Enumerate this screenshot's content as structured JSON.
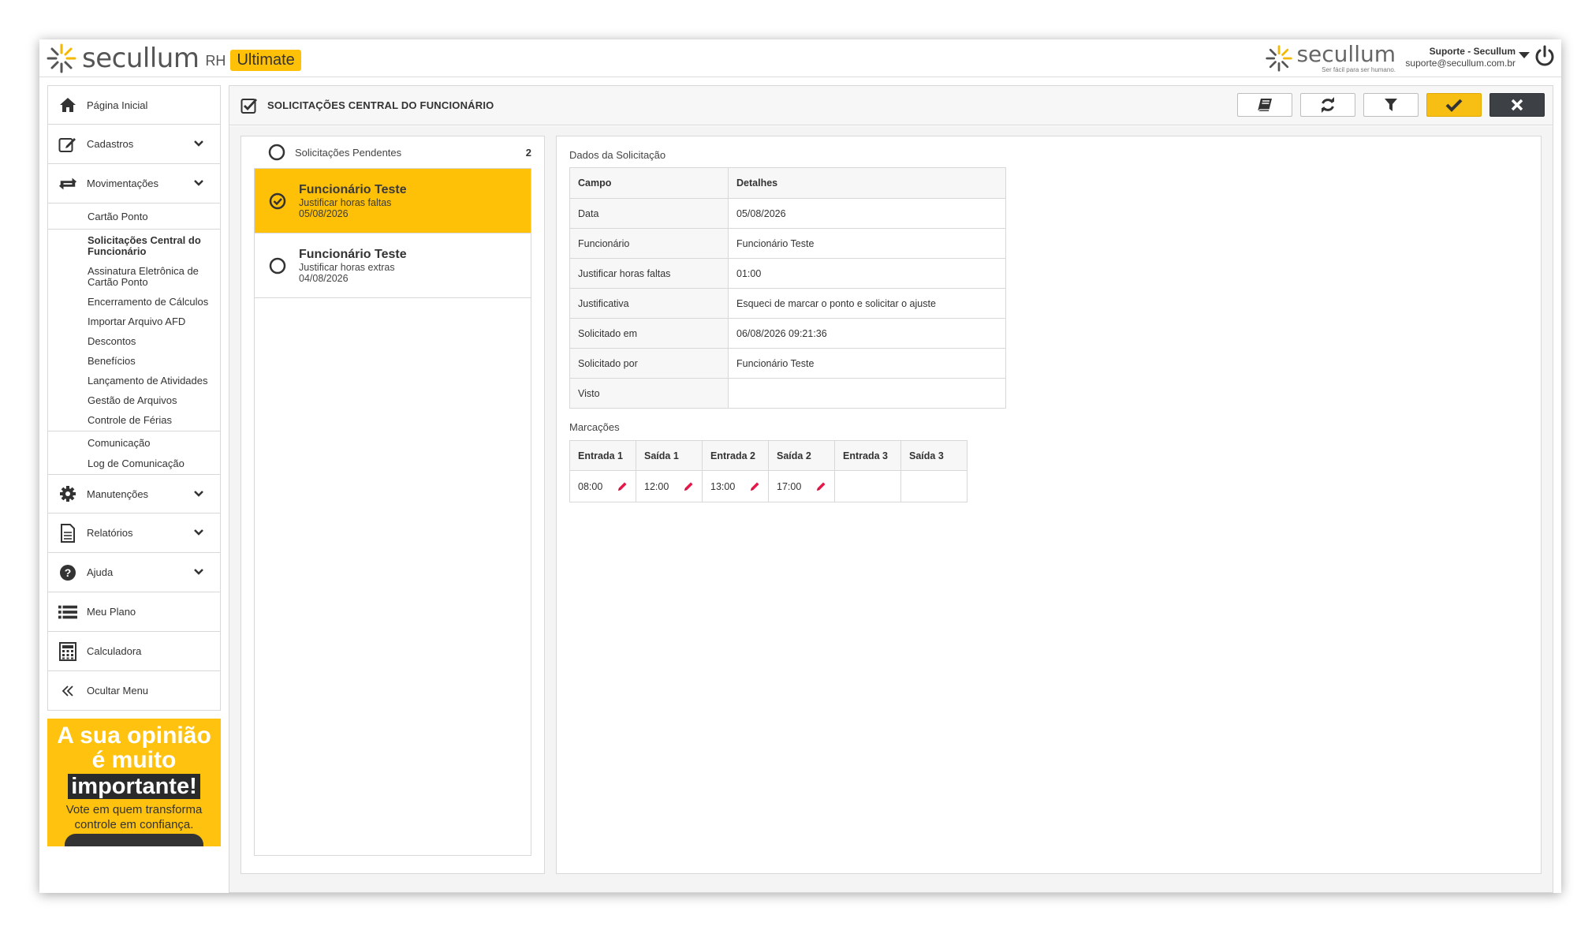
{
  "app": {
    "brand": "secullum",
    "product": "RH",
    "edition": "Ultimate",
    "right_brand": "secullum",
    "right_tagline": "Ser fácil para ser humano.",
    "accent_color": "#ffc107"
  },
  "user": {
    "name": "Suporte - Secullum",
    "email": "suporte@secullum.com.br"
  },
  "sidebar": {
    "items": [
      {
        "label": "Página Inicial",
        "icon": "home-icon"
      },
      {
        "label": "Cadastros",
        "icon": "edit-icon"
      },
      {
        "label": "Movimentações",
        "icon": "transfer-icon"
      }
    ],
    "submenu": [
      "Cartão Ponto",
      "Solicitações Central do Funcionário",
      "Assinatura Eletrônica de Cartão Ponto",
      "Encerramento de Cálculos",
      "Importar Arquivo AFD",
      "Descontos",
      "Benefícios",
      "Lançamento de Atividades",
      "Gestão de Arquivos",
      "Controle de Férias",
      "Comunicação",
      "Log de Comunicação"
    ],
    "items_after": [
      {
        "label": "Manutenções",
        "icon": "gear-icon"
      },
      {
        "label": "Relatórios",
        "icon": "document-icon"
      },
      {
        "label": "Ajuda",
        "icon": "help-icon"
      },
      {
        "label": "Meu Plano",
        "icon": "list-icon"
      },
      {
        "label": "Calculadora",
        "icon": "calculator-icon"
      },
      {
        "label": "Ocultar Menu",
        "icon": "double-chevron-left-icon"
      }
    ]
  },
  "banner": {
    "line1": "A sua opinião",
    "line2": "é muito",
    "line3": "importante!",
    "line4": "Vote em quem transforma controle em confiança."
  },
  "page": {
    "title": "SOLICITAÇÕES CENTRAL DO FUNCIONÁRIO"
  },
  "pending": {
    "label": "Solicitações Pendentes",
    "count": "2",
    "requests": [
      {
        "name": "Funcionário Teste",
        "desc": "Justificar horas faltas",
        "date": "05/08/2026",
        "selected": true
      },
      {
        "name": "Funcionário Teste",
        "desc": "Justificar horas extras",
        "date": "04/08/2026",
        "selected": false
      }
    ]
  },
  "details": {
    "title": "Dados da Solicitação",
    "header_field": "Campo",
    "header_details": "Detalhes",
    "rows": [
      {
        "field": "Data",
        "value": "05/08/2026"
      },
      {
        "field": "Funcionário",
        "value": "Funcionário Teste"
      },
      {
        "field": "Justificar horas faltas",
        "value": "01:00"
      },
      {
        "field": "Justificativa",
        "value": "Esqueci de marcar o ponto e solicitar o ajuste"
      },
      {
        "field": "Solicitado em",
        "value": "06/08/2026 09:21:36"
      },
      {
        "field": "Solicitado por",
        "value": "Funcionário Teste"
      },
      {
        "field": "Visto",
        "value": ""
      }
    ]
  },
  "marks": {
    "title": "Marcações",
    "headers": [
      "Entrada 1",
      "Saída 1",
      "Entrada 2",
      "Saída 2",
      "Entrada 3",
      "Saída 3"
    ],
    "values": [
      "08:00",
      "12:00",
      "13:00",
      "17:00",
      "",
      ""
    ]
  }
}
